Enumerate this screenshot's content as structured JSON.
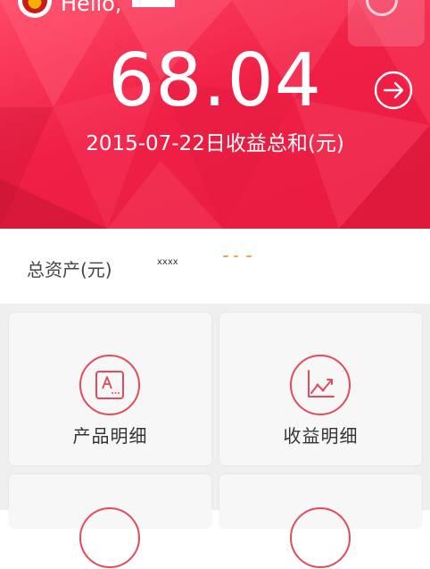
{
  "header": {
    "greeting": "Hello,",
    "amount": "68.04",
    "caption": "2015-07-22日收益总和(元)"
  },
  "assets": {
    "label": "总资产(元)",
    "value": "xxxx"
  },
  "grid": {
    "items": [
      {
        "label": "产品明细",
        "icon": "document-a-icon"
      },
      {
        "label": "收益明细",
        "icon": "line-chart-icon"
      }
    ]
  },
  "colors": {
    "brand_red": "#f01f46",
    "accent_orange": "#f5a04a",
    "tile_icon_red": "#e24a5e"
  }
}
